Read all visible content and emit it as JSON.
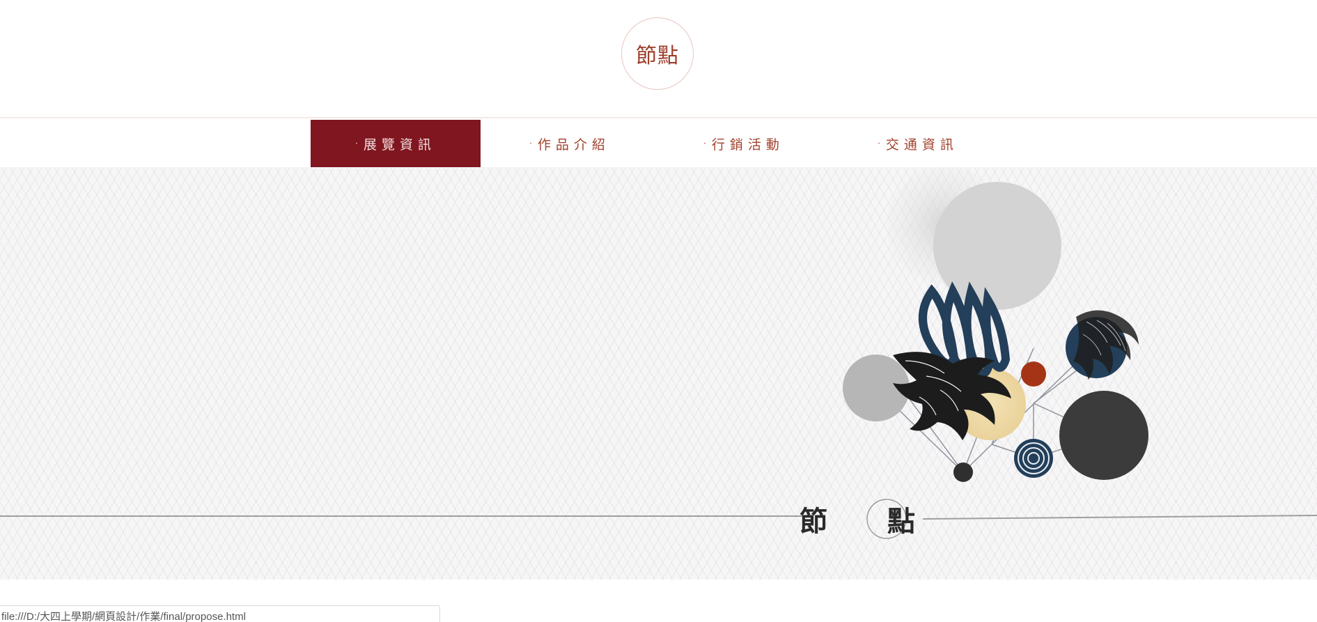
{
  "header": {
    "logo_text": "節點"
  },
  "nav": {
    "dot": "·",
    "items": [
      {
        "label": "展覽資訊",
        "active": true
      },
      {
        "label": "作品介紹",
        "active": false
      },
      {
        "label": "行銷活動",
        "active": false
      },
      {
        "label": "交通資訊",
        "active": false
      }
    ]
  },
  "hero": {
    "title_char_1": "節",
    "title_char_2": "點"
  },
  "status_bar": {
    "url": "file:///D:/大四上學期/網頁設計/作業/final/propose.html"
  },
  "colors": {
    "brand_red": "#7f1620",
    "nav_text": "#a3422c",
    "logo_text": "#9c3b27",
    "navy": "#233f5a",
    "accent_orange": "#a53416",
    "gold": "#efd9a3"
  }
}
